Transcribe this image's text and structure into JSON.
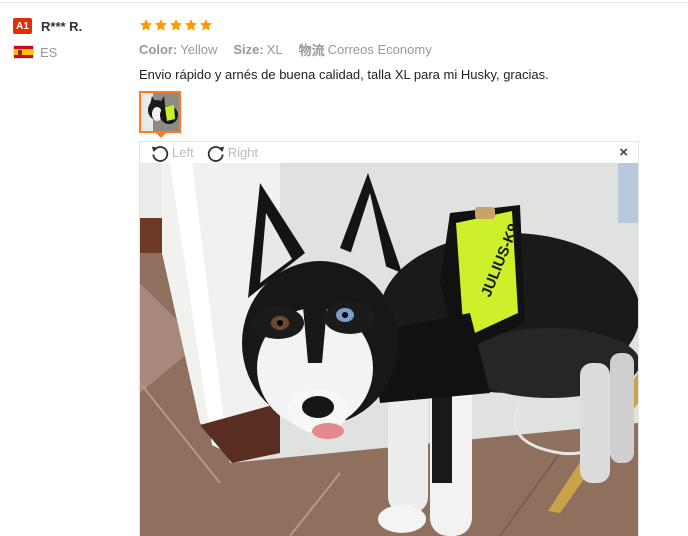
{
  "buyer": {
    "level_badge": "A1",
    "name": "R*** R.",
    "country_code": "ES",
    "country_flag_icon": "spain-flag-icon"
  },
  "review": {
    "rating": 5,
    "rating_max": 5,
    "star_color": "#ff9a00",
    "attributes": [
      {
        "key": "Color:",
        "value": "Yellow"
      },
      {
        "key": "Size:",
        "value": "XL"
      },
      {
        "key": "物流",
        "value": "Correos Economy"
      }
    ],
    "text": "Envio rápido y arnés de buena calidad, talla XL para mi Husky, gracias."
  },
  "viewer": {
    "rotate_left_label": "Left",
    "rotate_right_label": "Right",
    "close_glyph": "×",
    "harness_print": "JULIUS-K9",
    "accent_color": "#ff7a23"
  }
}
